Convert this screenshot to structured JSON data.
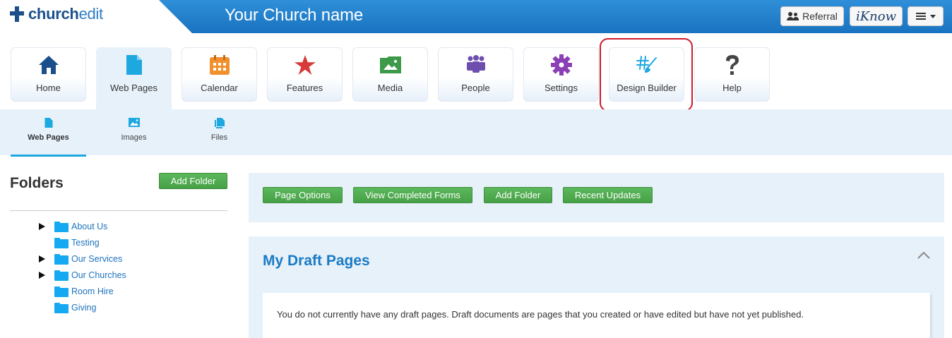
{
  "header": {
    "logo_bold": "church",
    "logo_light": "edit",
    "church_name": "Your Church name",
    "referral_label": "Referral",
    "iknow_label": "iKnow"
  },
  "tabs": [
    {
      "label": "Home",
      "icon": "home-icon",
      "color": "#1a4f8c"
    },
    {
      "label": "Web Pages",
      "icon": "page-icon",
      "color": "#1ea8e0"
    },
    {
      "label": "Calendar",
      "icon": "calendar-icon",
      "color": "#f0902e"
    },
    {
      "label": "Features",
      "icon": "star-icon",
      "color": "#d83a3a"
    },
    {
      "label": "Media",
      "icon": "image-icon",
      "color": "#3c9a4a"
    },
    {
      "label": "People",
      "icon": "people-icon",
      "color": "#6e4fb0"
    },
    {
      "label": "Settings",
      "icon": "gear-icon",
      "color": "#8a3fb5"
    },
    {
      "label": "Design Builder",
      "icon": "design-tools-icon",
      "color": "#1ea8e0"
    },
    {
      "label": "Help",
      "icon": "question-icon",
      "color": "#444444"
    }
  ],
  "subtabs": [
    {
      "label": "Web Pages",
      "icon": "page-icon"
    },
    {
      "label": "Images",
      "icon": "image-icon"
    },
    {
      "label": "Files",
      "icon": "files-icon"
    }
  ],
  "folders": {
    "title": "Folders",
    "add_folder_label": "Add Folder",
    "items": [
      {
        "label": "About Us",
        "expandable": true
      },
      {
        "label": "Testing",
        "expandable": false
      },
      {
        "label": "Our Services",
        "expandable": true
      },
      {
        "label": "Our Churches",
        "expandable": true
      },
      {
        "label": "Room Hire",
        "expandable": false
      },
      {
        "label": "Giving",
        "expandable": false
      }
    ]
  },
  "actions": {
    "page_options": "Page Options",
    "view_completed_forms": "View Completed Forms",
    "add_folder": "Add Folder",
    "recent_updates": "Recent Updates"
  },
  "drafts": {
    "title": "My Draft Pages",
    "message": "You do not currently have any draft pages. Draft documents are pages that you created or have edited but have not yet published."
  },
  "colors": {
    "brand_blue": "#1a73c0",
    "accent_green": "#5cb85c",
    "highlight_red": "#cc1b2c",
    "panel_bg": "#e7f1fa",
    "link_blue": "#1e73be"
  }
}
